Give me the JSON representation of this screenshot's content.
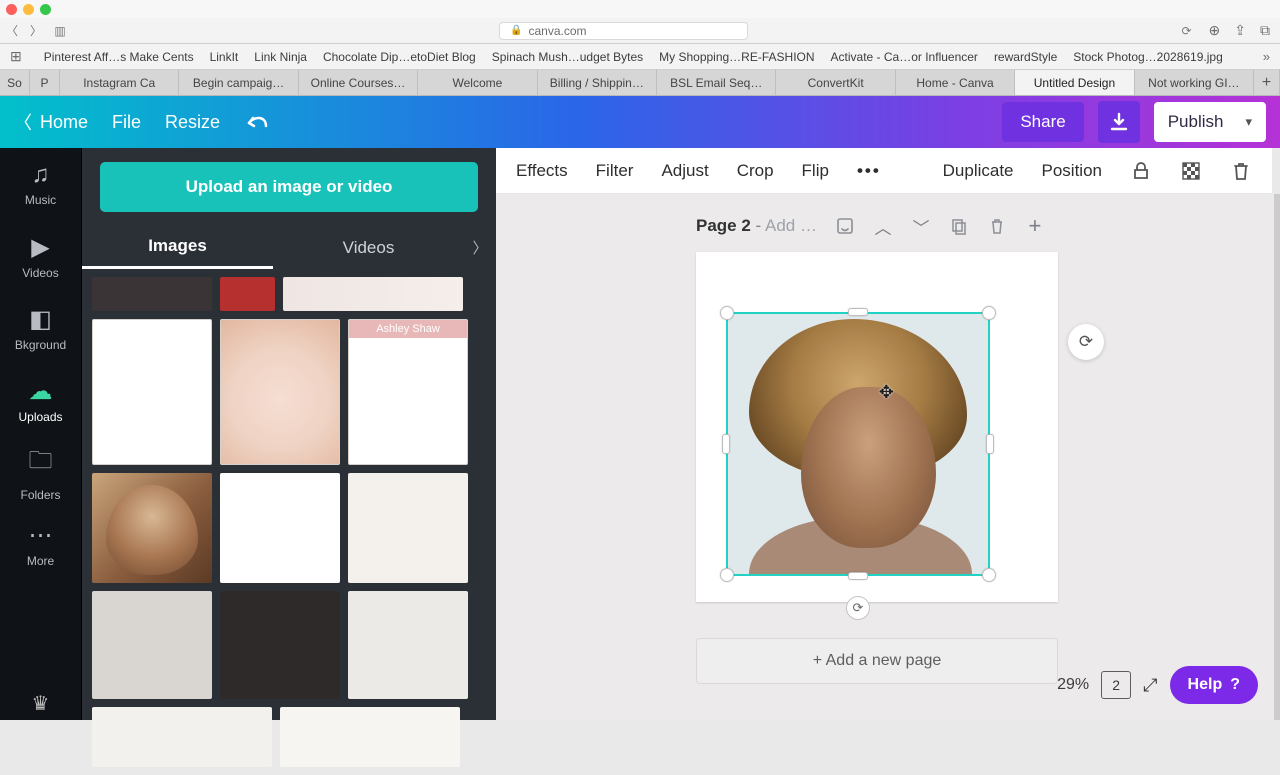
{
  "browser": {
    "url": "canva.com",
    "bookmarks": [
      "Pinterest Aff…s Make Cents",
      "LinkIt",
      "Link Ninja",
      "Chocolate Dip…etoDiet Blog",
      "Spinach Mush…udget Bytes",
      "My Shopping…RE-FASHION",
      "Activate - Ca…or Influencer",
      "rewardStyle",
      "Stock Photog…2028619.jpg"
    ],
    "tabs": [
      "So",
      "P",
      "Instagram Ca",
      "Begin campaig…",
      "Online Courses…",
      "Welcome",
      "Billing / Shippin…",
      "BSL Email Seq…",
      "ConvertKit",
      "Home - Canva",
      "Untitled Design",
      "Not working GI…"
    ],
    "active_tab_index": 10
  },
  "canva_top": {
    "home": "Home",
    "file": "File",
    "resize": "Resize",
    "share": "Share",
    "publish": "Publish"
  },
  "context_bar": {
    "items": [
      "Effects",
      "Filter",
      "Adjust",
      "Crop",
      "Flip"
    ],
    "right": [
      "Duplicate",
      "Position"
    ]
  },
  "rail": [
    {
      "label": "Music",
      "icon": "♪"
    },
    {
      "label": "Videos",
      "icon": "▶"
    },
    {
      "label": "Bkground",
      "icon": "◧"
    },
    {
      "label": "Uploads",
      "icon": "☁",
      "active": true
    },
    {
      "label": "Folders",
      "icon": "🗀"
    },
    {
      "label": "More",
      "icon": "⋯"
    }
  ],
  "panel": {
    "upload_btn": "Upload an image or video",
    "tabs": {
      "images": "Images",
      "videos": "Videos"
    },
    "active_tab": "images",
    "thumb_label_ashley": "Ashley Shaw"
  },
  "page_head": {
    "label": "Page 2",
    "placeholder": "Add …"
  },
  "canvas": {
    "add_page": "+ Add a new page",
    "zoom": "29%",
    "page_count": "2",
    "help": "Help"
  }
}
